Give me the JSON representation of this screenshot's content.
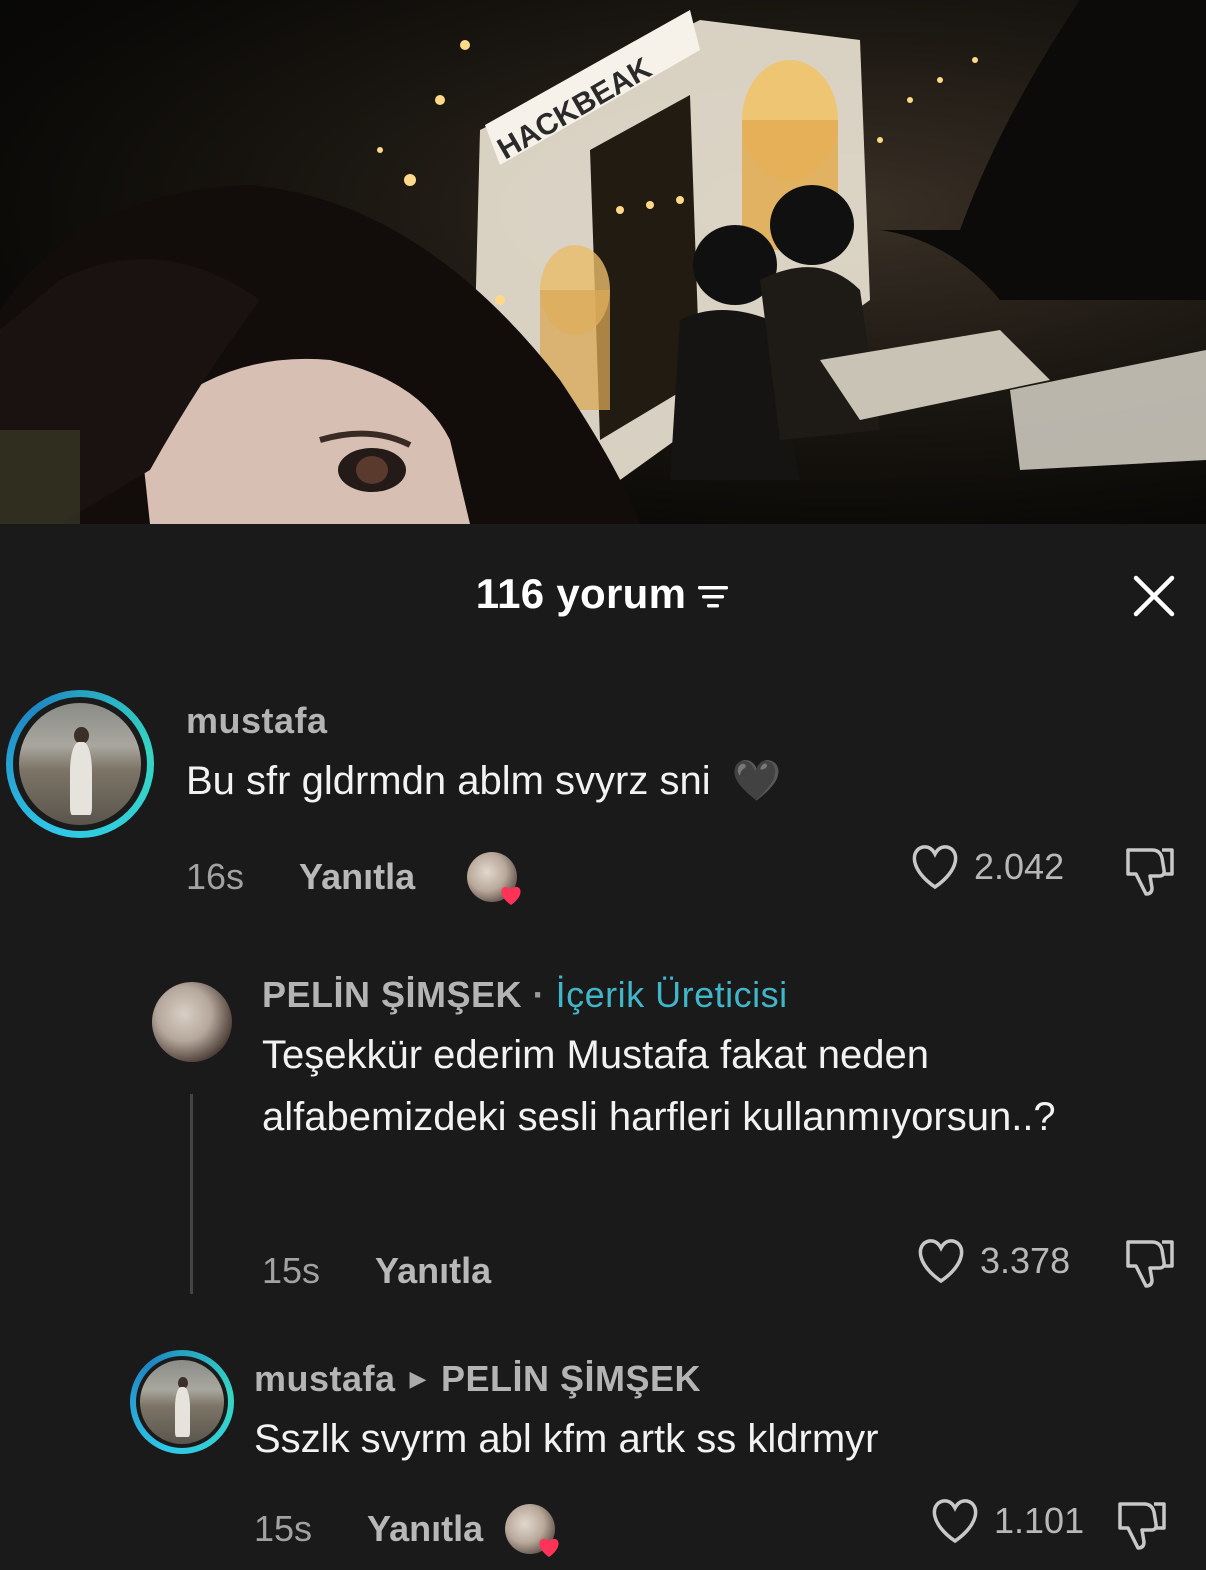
{
  "photo": {
    "sign_text": "HACKBEAK"
  },
  "comments_panel": {
    "title": "116 yorum",
    "sort_icon": "sort-lines-icon",
    "close_icon": "close-x-icon"
  },
  "comments": [
    {
      "username": "mustafa",
      "text": "Bu sfr gldrmdn ablm svyrz sni",
      "emoji": "🖤",
      "time": "16s",
      "reply_label": "Yanıtla",
      "likes": "2.042",
      "creator_liked": true
    },
    {
      "username": "PELİN ŞİMŞEK",
      "separator": "·",
      "badge": "İçerik Üreticisi",
      "text": "Teşekkür ederim Mustafa fakat neden alfabemizdeki sesli harfleri kullanmıyorsun..?",
      "time": "15s",
      "reply_label": "Yanıtla",
      "likes": "3.378"
    },
    {
      "username": "mustafa",
      "reply_to": "PELİN ŞİMŞEK",
      "text": "Sszlk svyrm abl kfm artk ss kldrmyr",
      "time": "15s",
      "reply_label": "Yanıtla",
      "likes": "1.101",
      "creator_liked": true
    }
  ],
  "colors": {
    "background": "#1a1a1a",
    "creator_badge": "#3fb6c9",
    "avatar_ring": "#2fc8e8",
    "heart_badge": "#ff3358"
  }
}
